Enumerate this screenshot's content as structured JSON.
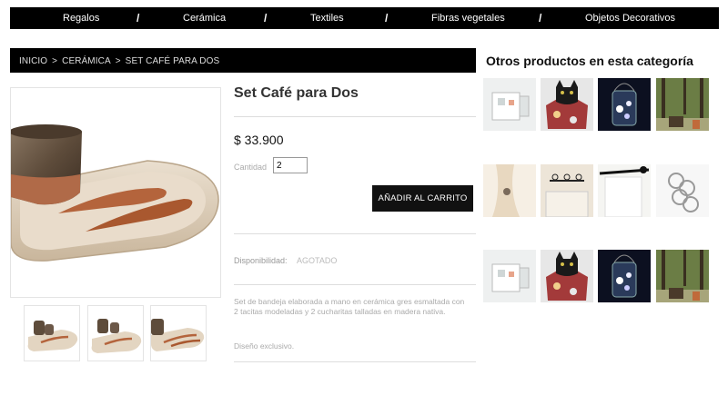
{
  "nav": {
    "items": [
      "Regalos",
      "Cerámica",
      "Textiles",
      "Fibras vegetales",
      "Objetos Decorativos"
    ],
    "separator": "/"
  },
  "breadcrumb": {
    "items": [
      "INICIO",
      "CERÁMICA",
      "SET CAFÉ PARA DOS"
    ],
    "separator": ">"
  },
  "product": {
    "title": "Set Café para Dos",
    "price": "$ 33.900",
    "quantity_label": "Cantidad",
    "quantity_value": "2",
    "add_to_cart_label": "AÑADIR AL CARRITO",
    "availability_label": "Disponibilidad:",
    "availability_value": "AGOTADO",
    "description": "Set de bandeja elaborada a mano en cerámica gres esmaltada con 2 tacitas modeladas y  2 cucharitas talladas en madera nativa.",
    "description_extra": "Diseño exclusivo."
  },
  "related": {
    "title": "Otros productos en esta categoría"
  },
  "colors": {
    "nav_bg": "#000000",
    "button_bg": "#111111"
  }
}
